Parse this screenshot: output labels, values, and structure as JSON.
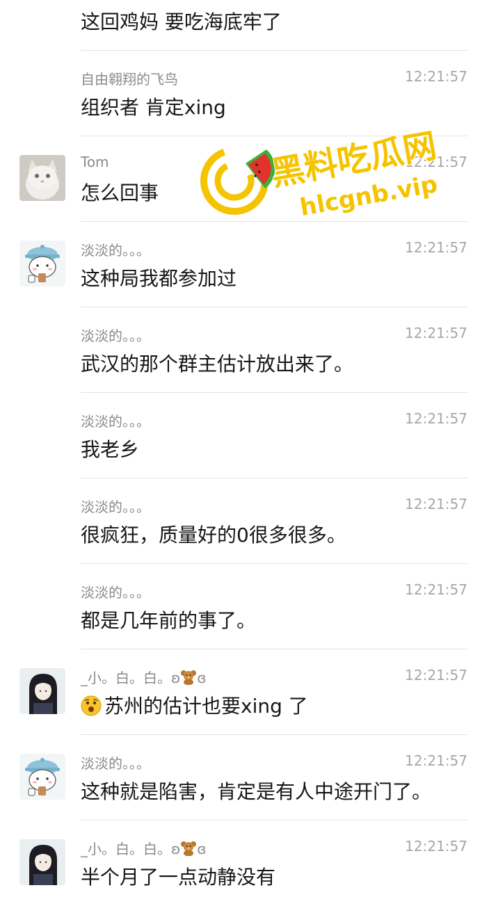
{
  "first_message": {
    "text": "这回鸡妈 要吃海底牢了"
  },
  "messages": [
    {
      "sender": "自由翱翔的飞鸟",
      "time": "12:21:57",
      "text": "组织者 肯定xing",
      "avatar": ""
    },
    {
      "sender": "Tom",
      "time": "12:21:57",
      "text": "怎么回事",
      "avatar": "cat-avatar"
    },
    {
      "sender": "淡淡的。。。",
      "time": "12:21:57",
      "text": "这种局我都参加过",
      "avatar": "bear-hat-avatar"
    },
    {
      "sender": "淡淡的。。。",
      "time": "12:21:57",
      "text": "武汉的那个群主估计放出来了。",
      "avatar": ""
    },
    {
      "sender": "淡淡的。。。",
      "time": "12:21:57",
      "text": "我老乡",
      "avatar": ""
    },
    {
      "sender": "淡淡的。。。",
      "time": "12:21:57",
      "text": "很疯狂，质量好的0很多很多。",
      "avatar": ""
    },
    {
      "sender": "淡淡的。。。",
      "time": "12:21:57",
      "text": "都是几年前的事了。",
      "avatar": ""
    },
    {
      "sender": "_小。白。白。ʚ",
      "sender_suffix": "ɞ",
      "time": "12:21:57",
      "text": "苏州的估计也要xing 了",
      "avatar": "girl-avatar",
      "emoji": "shocked-emoji"
    },
    {
      "sender": "淡淡的。。。",
      "time": "12:21:57",
      "text": "这种就是陷害，肯定是有人中途开门了。",
      "avatar": "bear-hat-avatar"
    },
    {
      "sender": "_小。白。白。ʚ",
      "sender_suffix": "ɞ",
      "time": "12:21:57",
      "text": "半个月了一点动静没有",
      "avatar": "girl-avatar"
    }
  ],
  "watermark": {
    "title": "黑料吃瓜网",
    "url": "hlcgnb.vip"
  },
  "colors": {
    "name": "#8a8a8a",
    "time": "#a6a6a6",
    "text": "#161616",
    "divider": "#e3e3e3",
    "watermark_yellow": "#f5c400"
  }
}
